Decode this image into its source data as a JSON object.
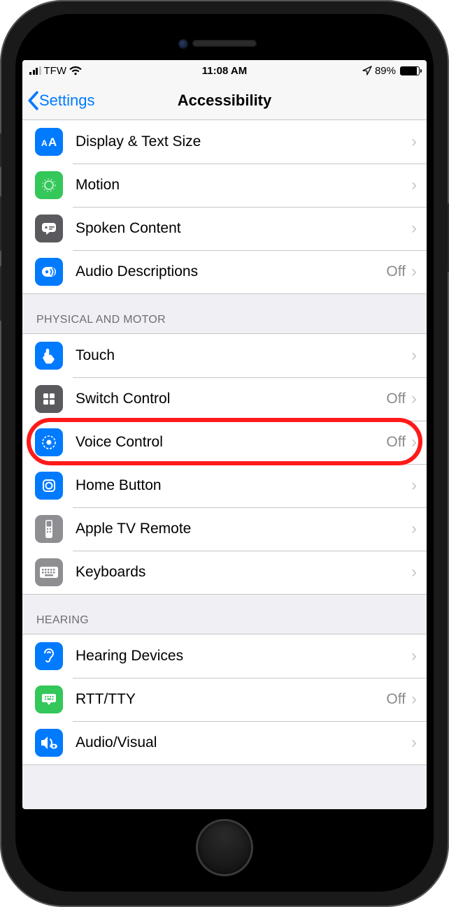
{
  "status_bar": {
    "carrier": "TFW",
    "time": "11:08 AM",
    "battery_percent": "89%"
  },
  "nav": {
    "back_label": "Settings",
    "title": "Accessibility"
  },
  "sections": {
    "vision": {
      "header": "",
      "items": [
        {
          "label": "Display & Text Size",
          "value": ""
        },
        {
          "label": "Motion",
          "value": ""
        },
        {
          "label": "Spoken Content",
          "value": ""
        },
        {
          "label": "Audio Descriptions",
          "value": "Off"
        }
      ]
    },
    "physical": {
      "header": "PHYSICAL AND MOTOR",
      "items": [
        {
          "label": "Touch",
          "value": ""
        },
        {
          "label": "Switch Control",
          "value": "Off"
        },
        {
          "label": "Voice Control",
          "value": "Off"
        },
        {
          "label": "Home Button",
          "value": ""
        },
        {
          "label": "Apple TV Remote",
          "value": ""
        },
        {
          "label": "Keyboards",
          "value": ""
        }
      ]
    },
    "hearing": {
      "header": "HEARING",
      "items": [
        {
          "label": "Hearing Devices",
          "value": ""
        },
        {
          "label": "RTT/TTY",
          "value": "Off"
        },
        {
          "label": "Audio/Visual",
          "value": ""
        }
      ]
    }
  },
  "highlight_row_index": 2
}
